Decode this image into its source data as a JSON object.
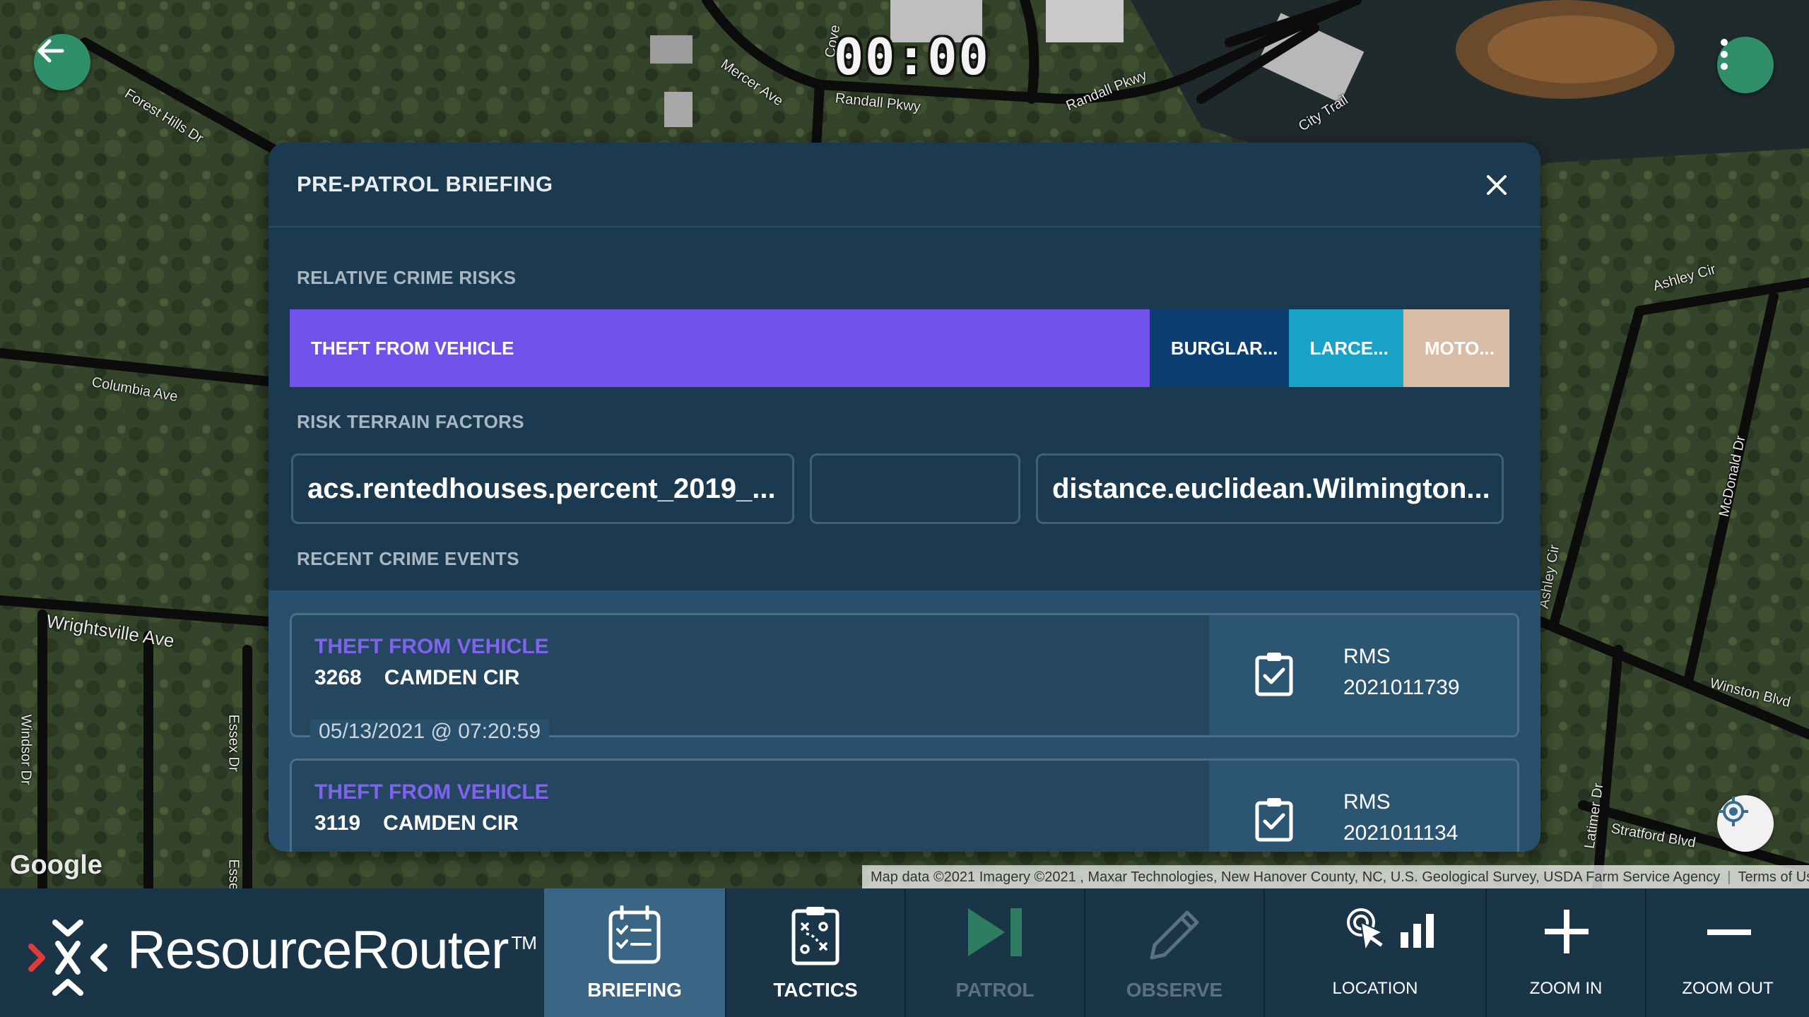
{
  "timer": "00:00",
  "map": {
    "street_labels": [
      "Forest Hills Dr",
      "Mercer Ave",
      "Cove",
      "Randall Pkwy",
      "Randall Pkwy",
      "City Trail",
      "Columbia Ave",
      "Wrightsville Ave",
      "Windsor Dr",
      "Essex Dr",
      "Essex Dr",
      "Ashley Cir",
      "McDonald Dr",
      "Ashley Cir",
      "Winston Blvd",
      "Stratford Blvd",
      "Latimer Dr"
    ],
    "google_logo": "Google",
    "attribution": "Map data ©2021 Imagery ©2021 , Maxar Technologies, New Hanover County, NC, U.S. Geological Survey, USDA Farm Service Agency",
    "terms": "Terms of Use",
    "icons": {
      "back": "arrow-left-icon",
      "menu": "more-vertical-icon",
      "locate": "crosshair-icon"
    }
  },
  "modal": {
    "title": "PRE-PATROL BRIEFING",
    "close_icon": "close-icon",
    "crime_risks_label": "RELATIVE CRIME RISKS",
    "crime_risks": [
      {
        "label": "THEFT FROM VEHICLE",
        "share": 0.705,
        "color": "#7153ec"
      },
      {
        "label": "BURGLAR...",
        "share": 0.114,
        "color": "#0b3f74"
      },
      {
        "label": "LARCE...",
        "share": 0.094,
        "color": "#1aa3c8"
      },
      {
        "label": "MOTO...",
        "share": 0.087,
        "color": "#d9bca6"
      }
    ],
    "terrain_label": "RISK TERRAIN FACTORS",
    "terrain_factors": [
      "acs.rentedhouses.percent_2019_...",
      "",
      "distance.euclidean.Wilmington..."
    ],
    "events_label": "RECENT CRIME EVENTS",
    "events": [
      {
        "type": "THEFT FROM VEHICLE",
        "number": "3268",
        "street": "CAMDEN CIR",
        "date": "05/13/2021 @ 07:20:59",
        "source": "RMS",
        "id": "2021011739",
        "icon": "clipboard-check-icon"
      },
      {
        "type": "THEFT FROM VEHICLE",
        "number": "3119",
        "street": "CAMDEN CIR",
        "date": "",
        "source": "RMS",
        "id": "2021011134",
        "icon": "clipboard-check-icon"
      }
    ]
  },
  "bottombar": {
    "brand": "ResourceRouter",
    "trademark": "TM",
    "nav": [
      {
        "label": "BRIEFING",
        "icon": "calendar-checklist-icon",
        "state": "active"
      },
      {
        "label": "TACTICS",
        "icon": "tactics-clipboard-icon",
        "state": "normal"
      },
      {
        "label": "PATROL",
        "icon": "play-skip-icon",
        "state": "disabled"
      },
      {
        "label": "OBSERVE",
        "icon": "pencil-icon",
        "state": "disabled"
      }
    ],
    "tools": [
      {
        "label": "LOCATION",
        "icon": "touch-location-chart-icon"
      },
      {
        "label": "ZOOM IN",
        "icon": "plus-icon"
      },
      {
        "label": "ZOOM OUT",
        "icon": "minus-icon"
      }
    ],
    "colors": {
      "accent_green": "#2e9e74",
      "active_tab": "#3a6584",
      "patrol_icon": "#2e7d63"
    }
  }
}
